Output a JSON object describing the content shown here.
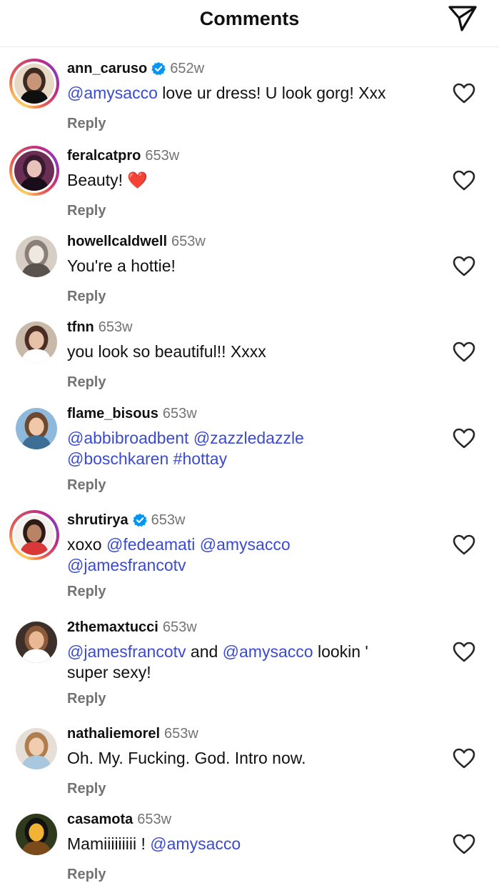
{
  "header": {
    "title": "Comments",
    "share_icon": "paper-plane-icon"
  },
  "reply_label": "Reply",
  "colors": {
    "mention": "#3a4bd1",
    "verified": "#0095f6",
    "muted": "#737373"
  },
  "comments": [
    {
      "username": "ann_caruso",
      "verified": true,
      "time": "652w",
      "story_ring": true,
      "text": [
        {
          "t": "@amysacco",
          "m": true
        },
        {
          "t": " love ur dress! U look gorg! Xxx",
          "m": false
        }
      ]
    },
    {
      "username": "feralcatpro",
      "verified": false,
      "time": "653w",
      "story_ring": true,
      "text": [
        {
          "t": "Beauty! ",
          "m": false
        },
        {
          "t": "❤️",
          "m": false
        }
      ]
    },
    {
      "username": "howellcaldwell",
      "verified": false,
      "time": "653w",
      "story_ring": false,
      "text": [
        {
          "t": "You're a hottie!",
          "m": false
        }
      ]
    },
    {
      "username": "tfnn",
      "verified": false,
      "time": "653w",
      "story_ring": false,
      "text": [
        {
          "t": "you look so beautiful!! Xxxx",
          "m": false
        }
      ]
    },
    {
      "username": "flame_bisous",
      "verified": false,
      "time": "653w",
      "story_ring": false,
      "text": [
        {
          "t": "@abbibroadbent",
          "m": true
        },
        {
          "t": " ",
          "m": false
        },
        {
          "t": "@zazzledazzle",
          "m": true
        },
        {
          "t": "\n",
          "m": false
        },
        {
          "t": "@boschkaren",
          "m": true
        },
        {
          "t": " ",
          "m": false
        },
        {
          "t": "#hottay",
          "m": true
        }
      ]
    },
    {
      "username": "shrutirya",
      "verified": true,
      "time": "653w",
      "story_ring": true,
      "text": [
        {
          "t": "xoxo ",
          "m": false
        },
        {
          "t": "@fedeamati",
          "m": true
        },
        {
          "t": " ",
          "m": false
        },
        {
          "t": "@amysacco",
          "m": true
        },
        {
          "t": "\n",
          "m": false
        },
        {
          "t": "@jamesfrancotv",
          "m": true
        }
      ]
    },
    {
      "username": "2themaxtucci",
      "verified": false,
      "time": "653w",
      "story_ring": false,
      "text": [
        {
          "t": "@jamesfrancotv",
          "m": true
        },
        {
          "t": " and ",
          "m": false
        },
        {
          "t": "@amysacco",
          "m": true
        },
        {
          "t": " lookin '\nsuper sexy!",
          "m": false
        }
      ]
    },
    {
      "username": "nathaliemorel",
      "verified": false,
      "time": "653w",
      "story_ring": false,
      "text": [
        {
          "t": "Oh. My. Fucking. God. Intro now.",
          "m": false
        }
      ]
    },
    {
      "username": "casamota",
      "verified": false,
      "time": "653w",
      "story_ring": false,
      "text": [
        {
          "t": "Mamiiiiiiiii ! ",
          "m": false
        },
        {
          "t": "@amysacco",
          "m": true
        }
      ]
    }
  ]
}
